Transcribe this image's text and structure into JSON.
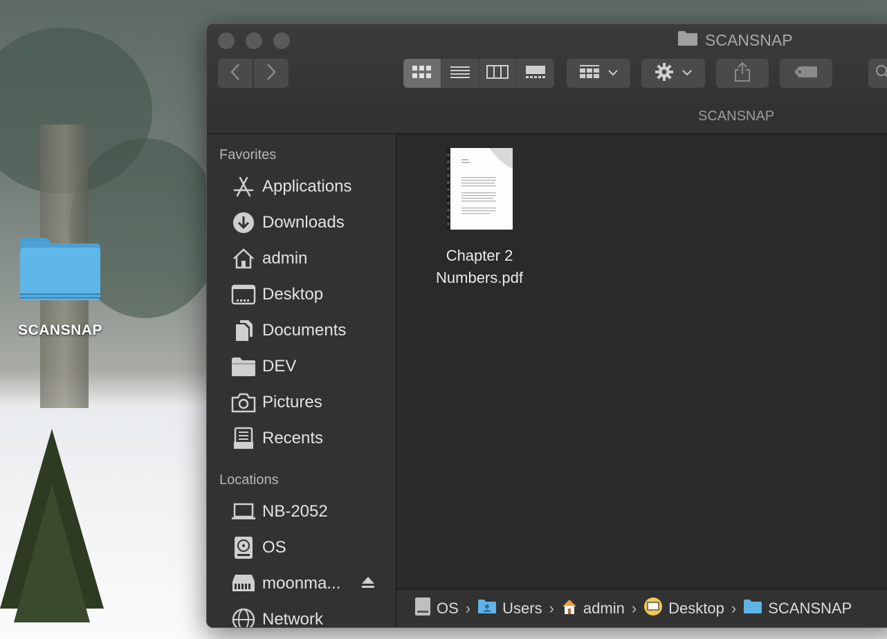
{
  "desktop": {
    "folder_label": "SCANSNAP"
  },
  "window": {
    "title": "SCANSNAP",
    "path_header": "SCANSNAP"
  },
  "toolbar": {
    "icons": [
      "chevron-left-icon",
      "chevron-right-icon",
      "icon-view-icon",
      "list-view-icon",
      "column-view-icon",
      "gallery-view-icon",
      "group-icon",
      "gear-icon",
      "share-icon",
      "tag-icon",
      "search-icon"
    ],
    "active_view": "icon-view"
  },
  "sidebar": {
    "favorites_heading": "Favorites",
    "favorites": [
      {
        "label": "Applications",
        "icon": "applications-icon"
      },
      {
        "label": "Downloads",
        "icon": "downloads-icon"
      },
      {
        "label": "admin",
        "icon": "home-icon"
      },
      {
        "label": "Desktop",
        "icon": "desktop-icon"
      },
      {
        "label": "Documents",
        "icon": "documents-icon"
      },
      {
        "label": "DEV",
        "icon": "folder-icon"
      },
      {
        "label": "Pictures",
        "icon": "camera-icon"
      },
      {
        "label": "Recents",
        "icon": "recents-icon"
      }
    ],
    "locations_heading": "Locations",
    "locations": [
      {
        "label": "NB-2052",
        "icon": "laptop-icon"
      },
      {
        "label": "OS",
        "icon": "disk-icon"
      },
      {
        "label": "moonma...",
        "icon": "network-drive-icon",
        "eject": true
      },
      {
        "label": "Network",
        "icon": "globe-icon"
      }
    ]
  },
  "files": [
    {
      "name_line1": "Chapter 2",
      "name_line2": "Numbers.pdf",
      "icon": "pdf-document-icon"
    }
  ],
  "pathbar": [
    {
      "label": "OS",
      "icon": "disk-icon"
    },
    {
      "label": "Users",
      "icon": "users-folder-icon"
    },
    {
      "label": "admin",
      "icon": "home-icon"
    },
    {
      "label": "Desktop",
      "icon": "desktop-icon"
    },
    {
      "label": "SCANSNAP",
      "icon": "folder-icon"
    }
  ],
  "colors": {
    "window_bg": "#2b2b2b",
    "sidebar_bg": "#323232",
    "folder_blue": "#5fb3e6"
  }
}
